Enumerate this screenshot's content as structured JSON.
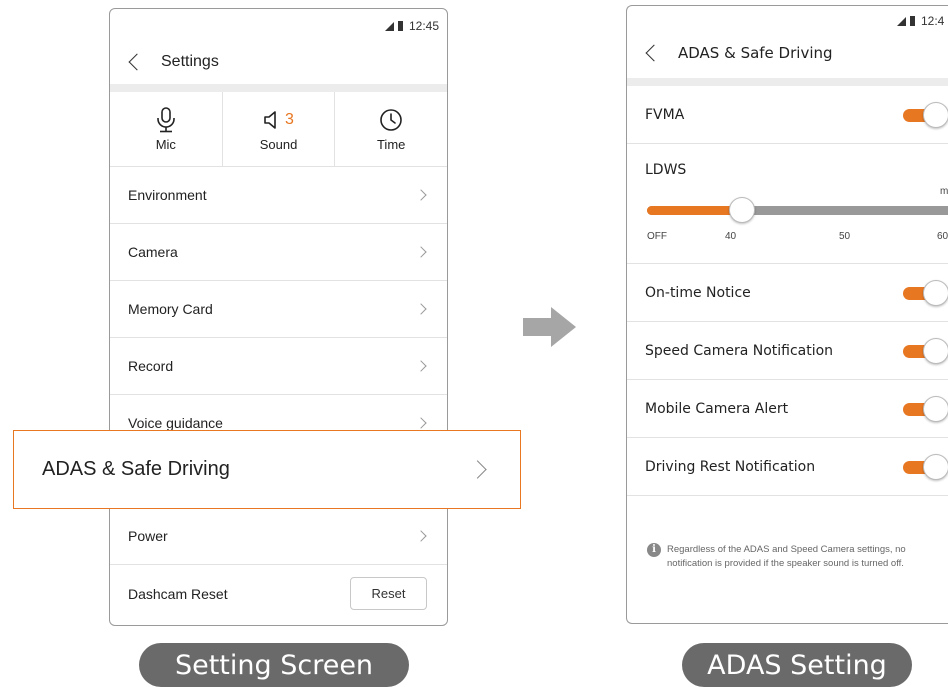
{
  "setting_screen": {
    "status": {
      "time": "12:45"
    },
    "title": "Settings",
    "quick": [
      {
        "icon": "mic-icon",
        "label": "Mic"
      },
      {
        "icon": "speaker-icon",
        "label": "Sound",
        "value": "3"
      },
      {
        "icon": "clock-icon",
        "label": "Time"
      }
    ],
    "menu": [
      {
        "label": "Environment"
      },
      {
        "label": "Camera"
      },
      {
        "label": "Memory Card"
      },
      {
        "label": "Record"
      },
      {
        "label": "Voice guidance"
      },
      {
        "label": "Power"
      },
      {
        "label": "Dashcam Reset",
        "button": "Reset"
      }
    ],
    "highlighted_item": "ADAS & Safe Driving",
    "caption": "Setting Screen"
  },
  "adas_screen": {
    "status": {
      "time": "12:4"
    },
    "title": "ADAS & Safe Driving",
    "fvma": {
      "label": "FVMA",
      "on": true
    },
    "ldws": {
      "label": "LDWS",
      "unit": "mph",
      "ticks": [
        "OFF",
        "40",
        "50",
        "60"
      ],
      "value": "40"
    },
    "toggles": [
      {
        "label": "On-time Notice",
        "on": true
      },
      {
        "label": "Speed Camera Notification",
        "on": true
      },
      {
        "label": "Mobile Camera Alert",
        "on": true
      },
      {
        "label": "Driving Rest Notification",
        "on": true
      }
    ],
    "note": "Regardless of the ADAS and Speed Camera settings, no notification is provided if the speaker sound is turned off.",
    "caption": "ADAS Setting"
  },
  "colors": {
    "accent": "#e87722",
    "caption_bg": "#6a6a6a",
    "arrow": "#a6a6a6"
  }
}
